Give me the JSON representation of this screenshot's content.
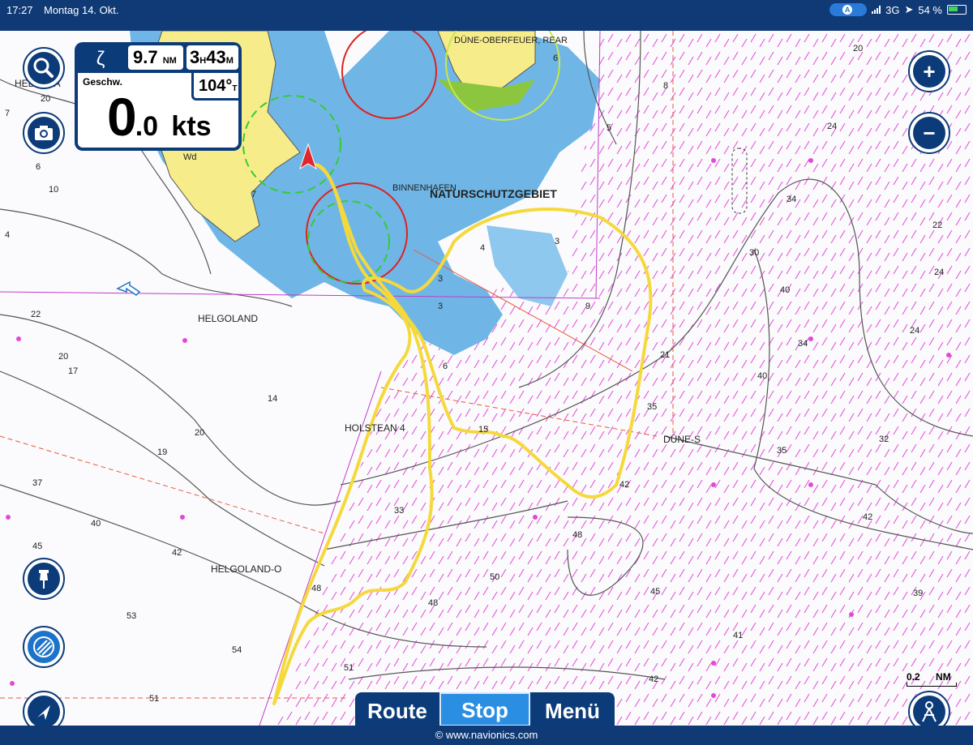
{
  "status_bar": {
    "time": "17:27",
    "date": "Montag 14. Okt.",
    "network": "3G",
    "battery": "54 %"
  },
  "panel": {
    "distance": "9.7",
    "distance_unit": "NM",
    "eta_h": "3",
    "eta_h_unit": "H",
    "eta_m": "43",
    "eta_m_unit": "M",
    "heading": "104°",
    "heading_unit": "T",
    "speed_label": "Geschw.",
    "speed_int": "0",
    "speed_dec": ".0",
    "speed_unit": "kts"
  },
  "chart_labels": {
    "naturschutz": "NATURSCHUTZGEBIET",
    "duene_oberfeuer": "DÜNE-OBERFEUER, REAR",
    "binnenhafen": "BINNENHAFEN",
    "helgoland": "HELGOLAND",
    "helgoland_top": "HELGOLA",
    "holstean": "HOLSTEAN 4",
    "duene_s": "DÜNE-S",
    "helgoland_o": "HELGOLAND-O",
    "wd": "Wd"
  },
  "depths": [
    "20",
    "7",
    "6",
    "10",
    "4",
    "22",
    "20",
    "17",
    "14",
    "20",
    "19",
    "37",
    "40",
    "42",
    "45",
    "53",
    "54",
    "51",
    "48",
    "51",
    "33",
    "48",
    "50",
    "48",
    "45",
    "42",
    "39",
    "41",
    "42",
    "42",
    "35",
    "32",
    "34",
    "40",
    "30",
    "40",
    "24",
    "22",
    "24",
    "34",
    "24",
    "20",
    "8",
    "5",
    "6",
    "9",
    "3",
    "3",
    "4",
    "3",
    "21",
    "35",
    "15",
    "6",
    "7"
  ],
  "tabs": {
    "route": "Route",
    "stop": "Stop",
    "menu": "Menü"
  },
  "scale": {
    "value": "0.2",
    "unit": "NM"
  },
  "footer": "© www.navionics.com",
  "icons": [
    "search-icon",
    "camera-icon",
    "plus-icon",
    "minus-icon",
    "pin-icon",
    "layers-icon",
    "locate-icon",
    "person-icon",
    "battery-icon",
    "location-arrow-icon"
  ],
  "colors": {
    "navy": "#0c3b7a",
    "track": "#f5d93c",
    "land": "#f7ec8a",
    "shallow": "#6fb6e6",
    "magenta": "#e14ad6"
  }
}
